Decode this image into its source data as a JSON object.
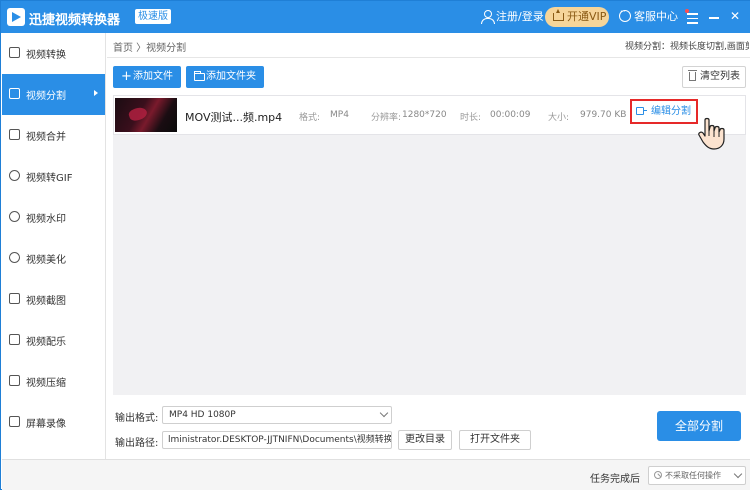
{
  "titlebar": {
    "app_name": "迅捷视频转换器",
    "badge": "极速版",
    "login": "注册/登录",
    "vip": "开通VIP",
    "service": "客服中心"
  },
  "sidebar": {
    "items": [
      {
        "label": "视频转换",
        "icon": "convert-icon"
      },
      {
        "label": "视频分割",
        "icon": "split-icon",
        "active": true
      },
      {
        "label": "视频合并",
        "icon": "merge-icon"
      },
      {
        "label": "视频转GIF",
        "icon": "gif-icon"
      },
      {
        "label": "视频水印",
        "icon": "watermark-icon"
      },
      {
        "label": "视频美化",
        "icon": "beautify-icon"
      },
      {
        "label": "视频截图",
        "icon": "screenshot-icon"
      },
      {
        "label": "视频配乐",
        "icon": "music-icon"
      },
      {
        "label": "视频压缩",
        "icon": "compress-icon"
      },
      {
        "label": "屏幕录像",
        "icon": "record-icon"
      }
    ]
  },
  "main": {
    "breadcrumb": "首页 〉视频分割",
    "info": "视频分割：视频长度切割,画面剪裁",
    "add_file": "添加文件",
    "add_folder": "添加文件夹",
    "clear_list": "清空列表"
  },
  "file": {
    "name": "MOV测试...频.mp4",
    "format_label": "格式:",
    "format_value": "MP4",
    "resolution_label": "分辨率:",
    "resolution_value": "1280*720",
    "duration_label": "时长:",
    "duration_value": "00:00:09",
    "size_label": "大小:",
    "size_value": "979.70 KB",
    "edit_split": "编辑分割"
  },
  "output": {
    "format_label": "输出格式:",
    "format_value": "MP4   HD 1080P",
    "path_label": "输出路径:",
    "path_value": "lministrator.DESKTOP-JJTNIFN\\Documents\\视频转换保存",
    "change_dir": "更改目录",
    "open_folder": "打开文件夹",
    "split_all": "全部分割"
  },
  "footer": {
    "label": "任务完成后",
    "select_value": "不采取任何操作"
  },
  "colors": {
    "accent": "#2a8ee6",
    "highlight_border": "#e62929"
  }
}
